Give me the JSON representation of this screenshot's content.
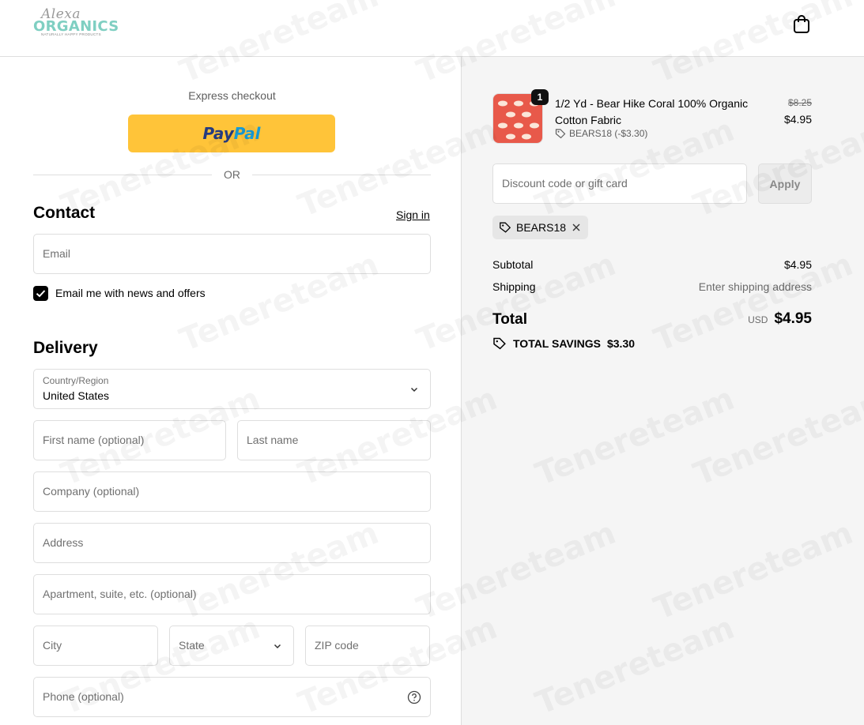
{
  "header": {
    "logo_script": "Alexa",
    "logo_main": "ORGANICS",
    "logo_tagline": "NATURALLY HAPPY PRODUCTS",
    "cart_icon": "shopping-bag-icon"
  },
  "express": {
    "title": "Express checkout",
    "paypal_part1": "Pay",
    "paypal_part2": "Pal",
    "divider": "OR"
  },
  "contact": {
    "heading": "Contact",
    "sign_in": "Sign in",
    "email_placeholder": "Email",
    "newsletter_label": "Email me with news and offers",
    "newsletter_checked": true
  },
  "delivery": {
    "heading": "Delivery",
    "country_label": "Country/Region",
    "country_value": "United States",
    "first_name": "First name (optional)",
    "last_name": "Last name",
    "company": "Company (optional)",
    "address": "Address",
    "apartment": "Apartment, suite, etc. (optional)",
    "city": "City",
    "state": "State",
    "zip": "ZIP code",
    "phone": "Phone (optional)"
  },
  "order": {
    "item": {
      "quantity": "1",
      "name": "1/2 Yd - Bear Hike Coral 100% Organic Cotton Fabric",
      "discount": "BEARS18 (-$3.30)",
      "original_price": "$8.25",
      "price": "$4.95",
      "thumb_color": "#e8594a"
    },
    "discount_placeholder": "Discount code or gift card",
    "apply_label": "Apply",
    "applied_code": "BEARS18",
    "subtotal_label": "Subtotal",
    "subtotal_value": "$4.95",
    "shipping_label": "Shipping",
    "shipping_value": "Enter shipping address",
    "total_label": "Total",
    "total_currency": "USD",
    "total_value": "$4.95",
    "savings_label": "TOTAL SAVINGS",
    "savings_value": "$3.30"
  },
  "watermark": "Tenereteam",
  "colors": {
    "paypal_yellow": "#ffc439",
    "logo_teal": "#7fcfc2",
    "summary_bg": "#f5f5f5"
  }
}
